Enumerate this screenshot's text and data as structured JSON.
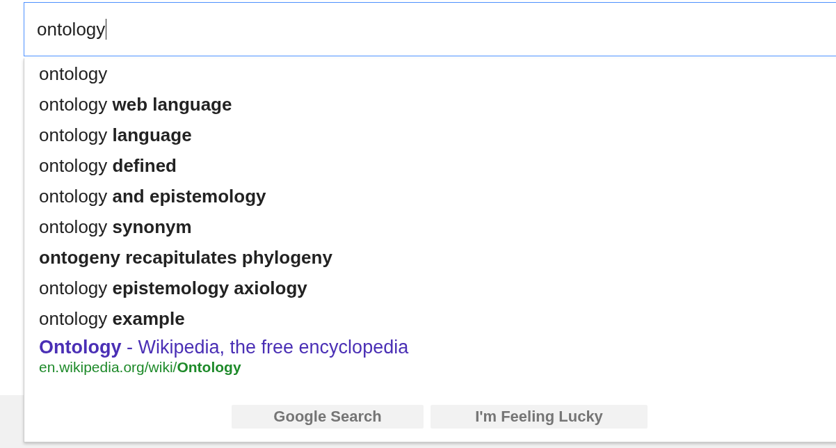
{
  "search": {
    "value": "ontology"
  },
  "suggestions": [
    {
      "text": "ontology",
      "bold": false
    },
    {
      "text": "ontology **web language**",
      "bold": false
    },
    {
      "text": "ontology **language**",
      "bold": false
    },
    {
      "text": "ontology **defined**",
      "bold": false
    },
    {
      "text": "ontology **and epistemology**",
      "bold": false
    },
    {
      "text": "ontology **synonym**",
      "bold": false
    },
    {
      "text": "ontogeny recapitulates phylogeny",
      "bold": true
    },
    {
      "text": "ontology **epistemology axiology**",
      "bold": false
    },
    {
      "text": "ontology **example**",
      "bold": false
    }
  ],
  "result": {
    "title": "**Ontology** - Wikipedia, the free encyclopedia",
    "url": "en.wikipedia.org/wiki/**Ontology**"
  },
  "buttons": [
    "Google Search",
    "I'm Feeling Lucky"
  ]
}
